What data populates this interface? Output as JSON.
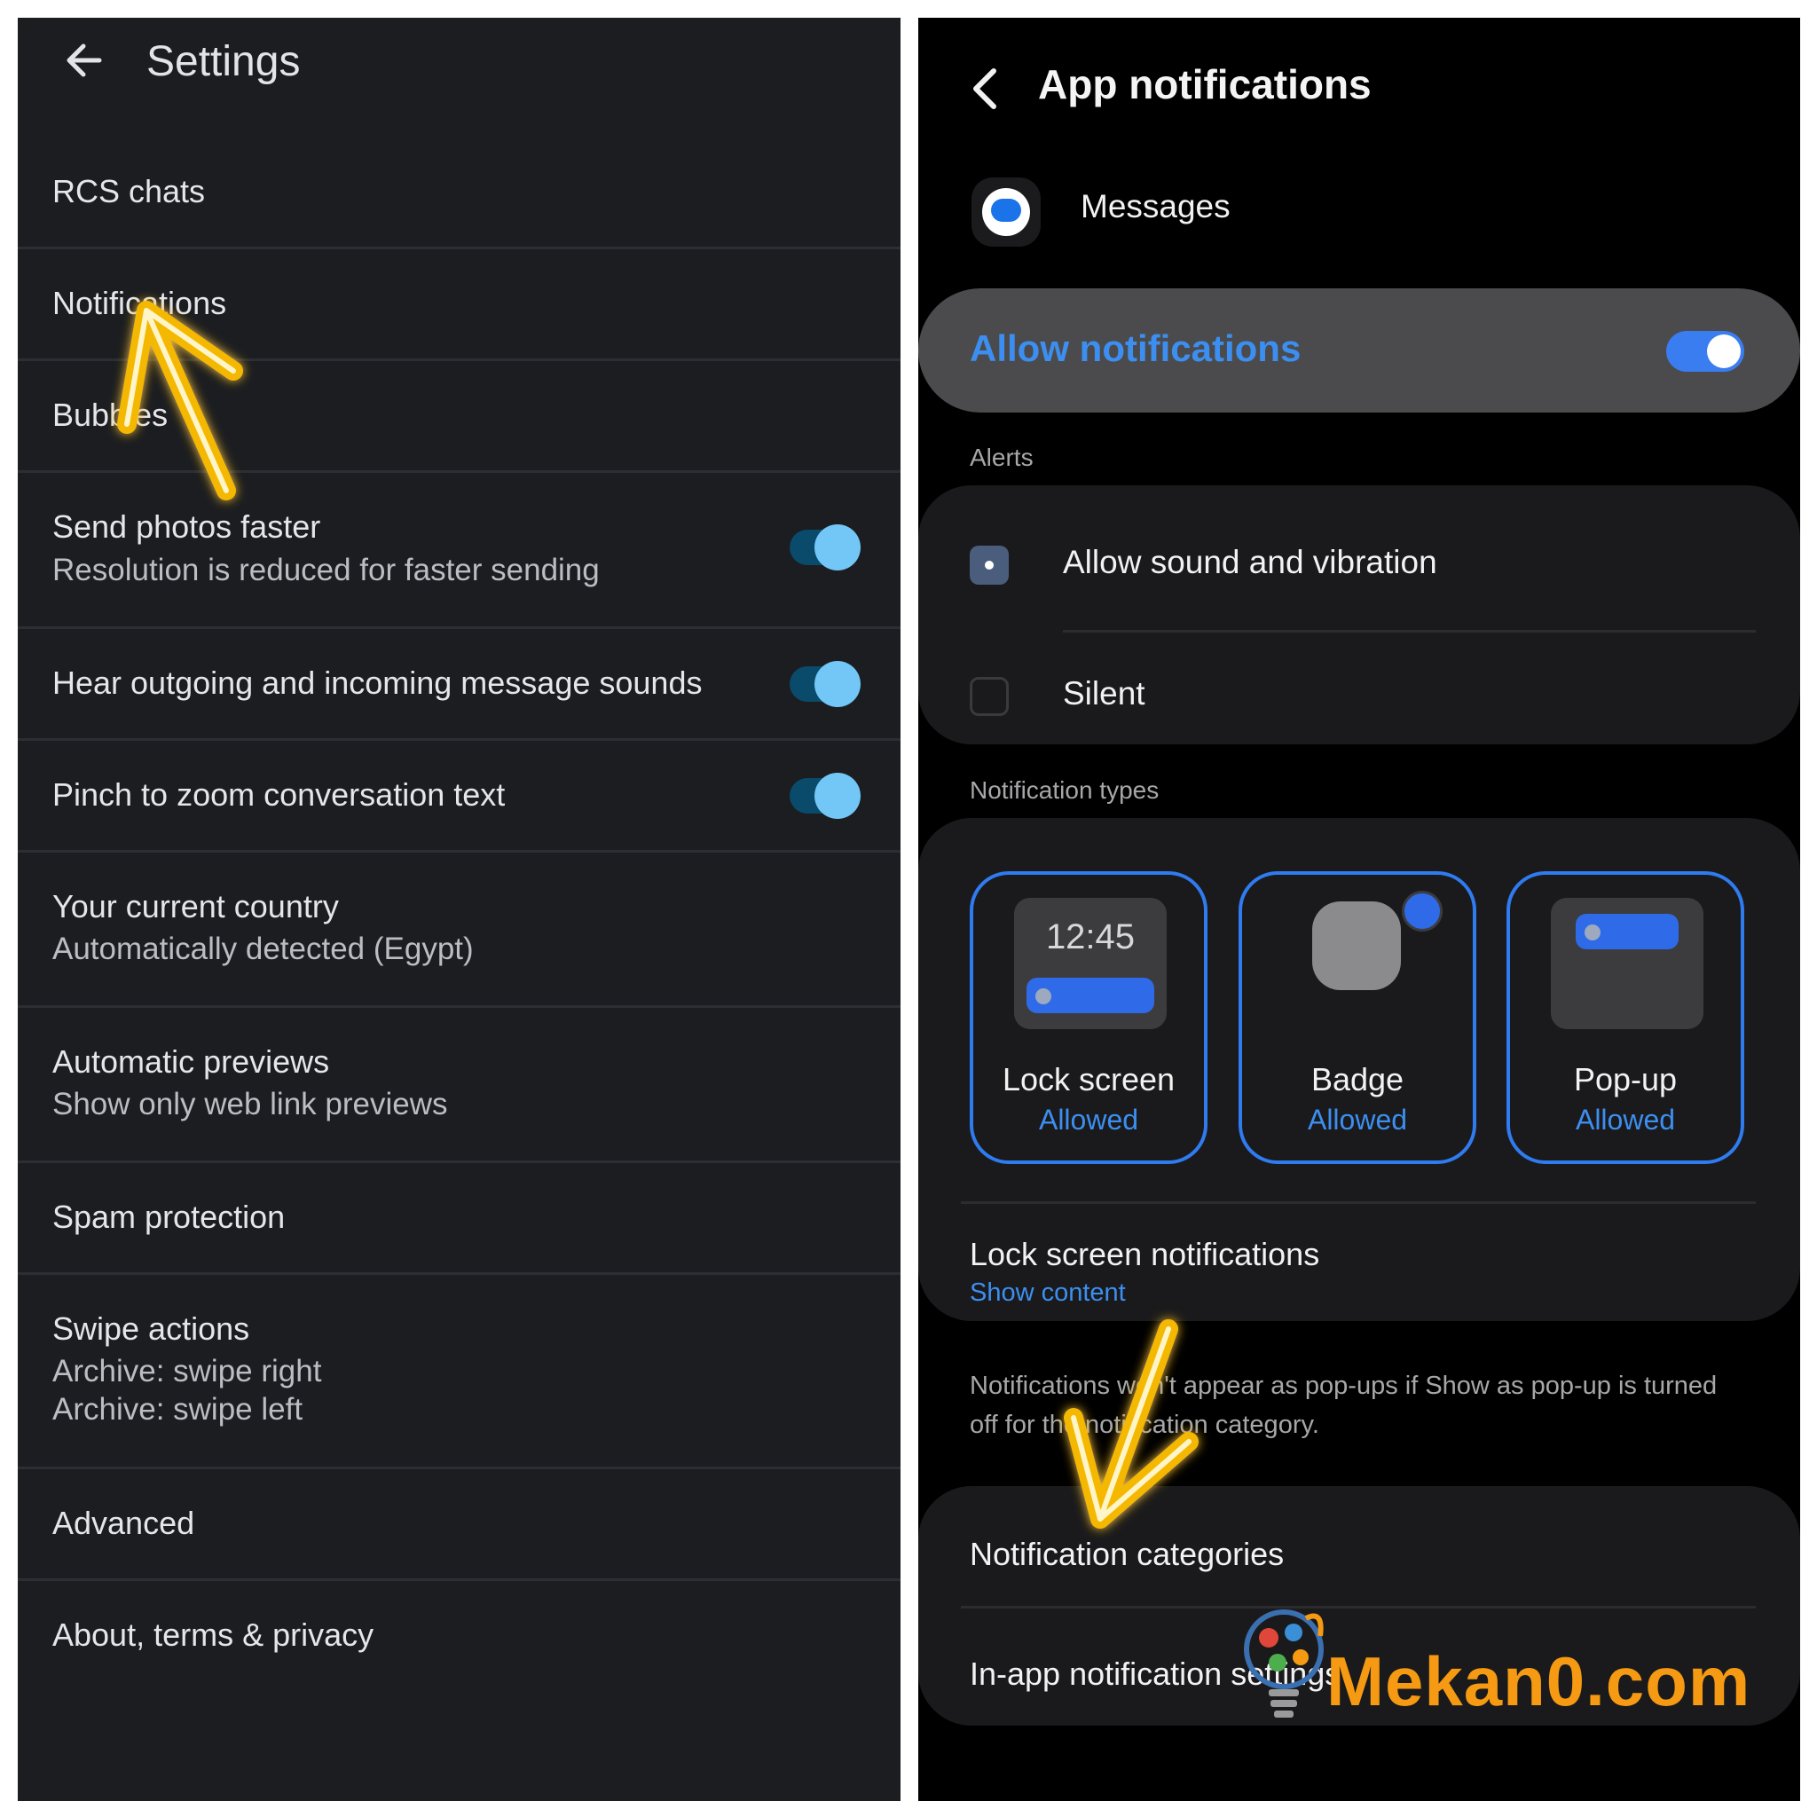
{
  "left": {
    "title": "Settings",
    "items": [
      {
        "title": "RCS chats"
      },
      {
        "title": "Notifications"
      },
      {
        "title": "Bubbles"
      },
      {
        "title": "Send photos faster",
        "subtitle": "Resolution is reduced for faster sending",
        "toggle": true
      },
      {
        "title": "Hear outgoing and incoming message sounds",
        "toggle": true
      },
      {
        "title": "Pinch to zoom conversation text",
        "toggle": true
      },
      {
        "title": "Your current country",
        "subtitle": "Automatically detected (Egypt)"
      },
      {
        "title": "Automatic previews",
        "subtitle": "Show only web link previews"
      },
      {
        "title": "Spam protection"
      },
      {
        "title": "Swipe actions",
        "subtitle": "Archive: swipe right",
        "subtitle2": "Archive: swipe left"
      },
      {
        "title": "Advanced"
      },
      {
        "title": "About, terms & privacy"
      }
    ]
  },
  "right": {
    "title": "App notifications",
    "app_name": "Messages",
    "allow_label": "Allow notifications",
    "allow_on": true,
    "alerts_header": "Alerts",
    "alert_options": [
      {
        "label": "Allow sound and vibration",
        "selected": true
      },
      {
        "label": "Silent",
        "selected": false
      }
    ],
    "types_header": "Notification types",
    "types": [
      {
        "label": "Lock screen",
        "status": "Allowed",
        "clock": "12:45"
      },
      {
        "label": "Badge",
        "status": "Allowed"
      },
      {
        "label": "Pop-up",
        "status": "Allowed"
      }
    ],
    "lock_screen_label": "Lock screen notifications",
    "lock_screen_value": "Show content",
    "note": "Notifications won't appear as pop-ups if Show as pop-up is turned off for the notification category.",
    "categories_label": "Notification categories",
    "inapp_label": "In-app notification settings"
  },
  "watermark": "Mekan0.com",
  "colors": {
    "accent_blue": "#3c8ff0",
    "highlight_arrow": "#f5b800",
    "watermark": "#f59a12"
  }
}
